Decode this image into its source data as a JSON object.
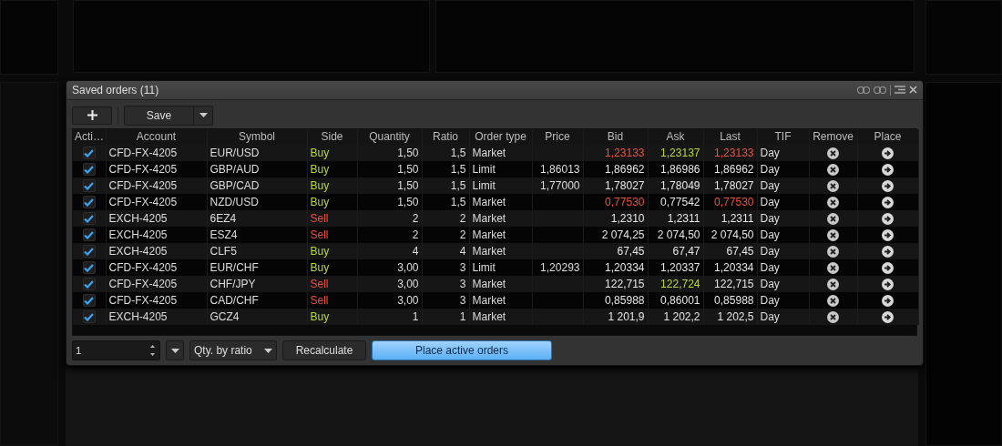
{
  "dialog": {
    "title": "Saved orders (11)"
  },
  "toolbar": {
    "save_label": "Save"
  },
  "table": {
    "columns": [
      "Acti…",
      "Account",
      "Symbol",
      "Side",
      "Quantity",
      "Ratio",
      "Order type",
      "Price",
      "Bid",
      "Ask",
      "Last",
      "TIF",
      "Remove",
      "Place"
    ],
    "rows": [
      {
        "active": true,
        "account": "CFD-FX-4205",
        "symbol": "EUR/USD",
        "side": {
          "label": "Buy",
          "kind": "buy"
        },
        "quantity": "1,50",
        "ratio": "1,5",
        "order_type": "Market",
        "price": "",
        "bid": {
          "value": "1,23133",
          "color": "#f0503c"
        },
        "ask": {
          "value": "1,23137",
          "color": "#b7d83e"
        },
        "last": {
          "value": "1,23133",
          "color": "#f0503c"
        },
        "tif": "Day"
      },
      {
        "active": true,
        "account": "CFD-FX-4205",
        "symbol": "GBP/AUD",
        "side": {
          "label": "Buy",
          "kind": "buy"
        },
        "quantity": "1,50",
        "ratio": "1,5",
        "order_type": "Limit",
        "price": "1,86013",
        "bid": {
          "value": "1,86962",
          "color": "#e6e6e6"
        },
        "ask": {
          "value": "1,86986",
          "color": "#e6e6e6"
        },
        "last": {
          "value": "1,86962",
          "color": "#e6e6e6"
        },
        "tif": "Day"
      },
      {
        "active": true,
        "account": "CFD-FX-4205",
        "symbol": "GBP/CAD",
        "side": {
          "label": "Buy",
          "kind": "buy"
        },
        "quantity": "1,50",
        "ratio": "1,5",
        "order_type": "Limit",
        "price": "1,77000",
        "bid": {
          "value": "1,78027",
          "color": "#e6e6e6"
        },
        "ask": {
          "value": "1,78049",
          "color": "#e6e6e6"
        },
        "last": {
          "value": "1,78027",
          "color": "#e6e6e6"
        },
        "tif": "Day"
      },
      {
        "active": true,
        "account": "CFD-FX-4205",
        "symbol": "NZD/USD",
        "side": {
          "label": "Buy",
          "kind": "buy"
        },
        "quantity": "1,50",
        "ratio": "1,5",
        "order_type": "Market",
        "price": "",
        "bid": {
          "value": "0,77530",
          "color": "#f0503c"
        },
        "ask": {
          "value": "0,77542",
          "color": "#e6e6e6"
        },
        "last": {
          "value": "0,77530",
          "color": "#f0503c"
        },
        "tif": "Day"
      },
      {
        "active": true,
        "account": "EXCH-4205",
        "symbol": "6EZ4",
        "side": {
          "label": "Sell",
          "kind": "sell"
        },
        "quantity": "2",
        "ratio": "2",
        "order_type": "Market",
        "price": "",
        "bid": {
          "value": "1,2310",
          "color": "#e6e6e6"
        },
        "ask": {
          "value": "1,2311",
          "color": "#e6e6e6"
        },
        "last": {
          "value": "1,2311",
          "color": "#e6e6e6"
        },
        "tif": "Day"
      },
      {
        "active": true,
        "account": "EXCH-4205",
        "symbol": "ESZ4",
        "side": {
          "label": "Sell",
          "kind": "sell"
        },
        "quantity": "2",
        "ratio": "2",
        "order_type": "Market",
        "price": "",
        "bid": {
          "value": "2 074,25",
          "color": "#e6e6e6"
        },
        "ask": {
          "value": "2 074,50",
          "color": "#e6e6e6"
        },
        "last": {
          "value": "2 074,50",
          "color": "#e6e6e6"
        },
        "tif": "Day"
      },
      {
        "active": true,
        "account": "EXCH-4205",
        "symbol": "CLF5",
        "side": {
          "label": "Buy",
          "kind": "buy"
        },
        "quantity": "4",
        "ratio": "4",
        "order_type": "Market",
        "price": "",
        "bid": {
          "value": "67,45",
          "color": "#e6e6e6"
        },
        "ask": {
          "value": "67,47",
          "color": "#e6e6e6"
        },
        "last": {
          "value": "67,45",
          "color": "#e6e6e6"
        },
        "tif": "Day"
      },
      {
        "active": true,
        "account": "CFD-FX-4205",
        "symbol": "EUR/CHF",
        "side": {
          "label": "Buy",
          "kind": "buy"
        },
        "quantity": "3,00",
        "ratio": "3",
        "order_type": "Limit",
        "price": "1,20293",
        "bid": {
          "value": "1,20334",
          "color": "#e6e6e6"
        },
        "ask": {
          "value": "1,20337",
          "color": "#e6e6e6"
        },
        "last": {
          "value": "1,20334",
          "color": "#e6e6e6"
        },
        "tif": "Day"
      },
      {
        "active": true,
        "account": "CFD-FX-4205",
        "symbol": "CHF/JPY",
        "side": {
          "label": "Sell",
          "kind": "sell"
        },
        "quantity": "3,00",
        "ratio": "3",
        "order_type": "Market",
        "price": "",
        "bid": {
          "value": "122,715",
          "color": "#e6e6e6"
        },
        "ask": {
          "value": "122,724",
          "color": "#b7d83e"
        },
        "last": {
          "value": "122,715",
          "color": "#e6e6e6"
        },
        "tif": "Day"
      },
      {
        "active": true,
        "account": "CFD-FX-4205",
        "symbol": "CAD/CHF",
        "side": {
          "label": "Sell",
          "kind": "sell"
        },
        "quantity": "3,00",
        "ratio": "3",
        "order_type": "Market",
        "price": "",
        "bid": {
          "value": "0,85988",
          "color": "#e6e6e6"
        },
        "ask": {
          "value": "0,86001",
          "color": "#e6e6e6"
        },
        "last": {
          "value": "0,85988",
          "color": "#e6e6e6"
        },
        "tif": "Day"
      },
      {
        "active": true,
        "account": "EXCH-4205",
        "symbol": "GCZ4",
        "side": {
          "label": "Buy",
          "kind": "buy"
        },
        "quantity": "1",
        "ratio": "1",
        "order_type": "Market",
        "price": "",
        "bid": {
          "value": "1 201,9",
          "color": "#e6e6e6"
        },
        "ask": {
          "value": "1 202,2",
          "color": "#e6e6e6"
        },
        "last": {
          "value": "1 202,5",
          "color": "#e6e6e6"
        },
        "tif": "Day"
      }
    ]
  },
  "footer": {
    "quantity_value": "1",
    "mode": "Qty. by ratio",
    "recalculate_label": "Recalculate",
    "place_label": "Place active orders"
  }
}
